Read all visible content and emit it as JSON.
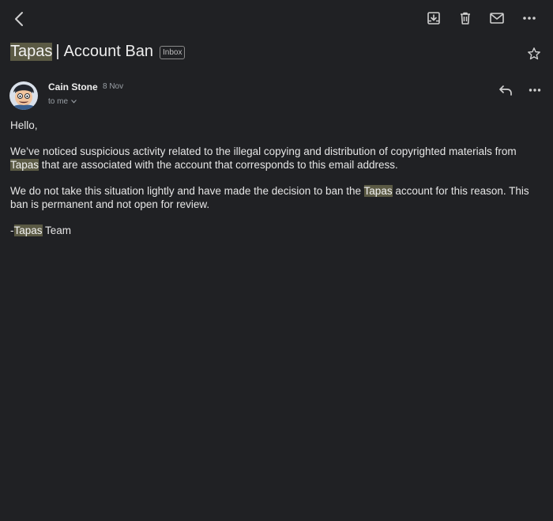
{
  "toolbar": {
    "back_icon": "back-arrow-icon",
    "archive_icon": "archive-icon",
    "delete_icon": "trash-icon",
    "mark_unread_icon": "envelope-icon",
    "more_icon": "more-dots-icon"
  },
  "email": {
    "subject_highlight": "Tapas",
    "subject_separator": "|",
    "subject_rest": "Account Ban",
    "label_badge": "Inbox",
    "starred": false,
    "sender_name": "Cain Stone",
    "date": "8 Nov",
    "recipient": "to me",
    "greeting": "Hello,",
    "p1_a": "We’ve noticed suspicious activity related to the illegal copying and distribution of copyrighted materials from ",
    "p1_highlight": "Tapas",
    "p1_b": " that are associated with the account that corresponds to this email address.",
    "p2_a": "We do not take this situation lightly and have made the decision to ban the ",
    "p2_highlight": "Tapas",
    "p2_b": " account for this reason. This ban is permanent and not open for review.",
    "sig_prefix": "-",
    "sig_highlight": "Tapas",
    "sig_rest": " Team"
  },
  "colors": {
    "background": "#202124",
    "text": "#e3e3e3",
    "highlight": "#5b5a44",
    "secondary_text": "#9aa0a6"
  }
}
